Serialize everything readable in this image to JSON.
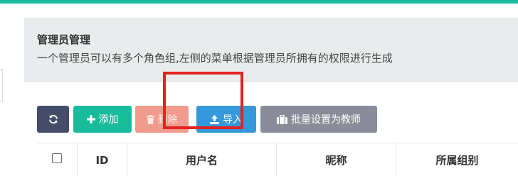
{
  "colors": {
    "accent": "#18bc9c",
    "refresh": "#444c69",
    "add": "#18bc9c",
    "delete": "#f19a8e",
    "import": "#3498db",
    "batch": "#8a8d99",
    "highlight": "#e32222"
  },
  "panel": {
    "title": "管理员管理",
    "description": "一个管理员可以有多个角色组,左侧的菜单根据管理员所拥有的权限进行生成"
  },
  "toolbar": {
    "refresh_icon": "refresh-icon",
    "add_icon": "plus-icon",
    "add_label": "添加",
    "delete_icon": "trash-icon",
    "delete_label": "删除",
    "import_icon": "upload-icon",
    "import_label": "导入",
    "batch_icon": "briefcase-icon",
    "batch_label": "批量设置为教师"
  },
  "table": {
    "columns": [
      "ID",
      "用户名",
      "昵称",
      "所属组别"
    ]
  }
}
